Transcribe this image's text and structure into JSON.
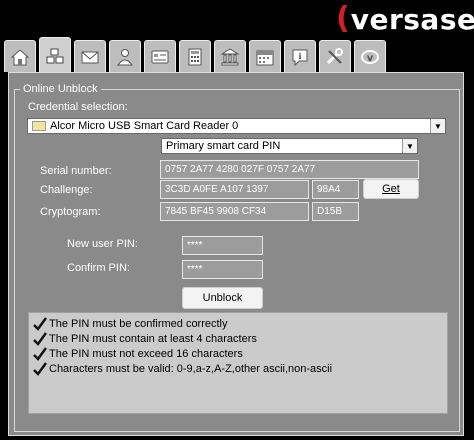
{
  "brand": {
    "logo_text": "versasec"
  },
  "tabs": [
    {
      "icon": "home-icon"
    },
    {
      "icon": "tools-grid-icon",
      "active": true
    },
    {
      "icon": "envelope-icon"
    },
    {
      "icon": "operator-icon"
    },
    {
      "icon": "id-card-icon"
    },
    {
      "icon": "calculator-icon"
    },
    {
      "icon": "bank-icon"
    },
    {
      "icon": "calendar-icon"
    },
    {
      "icon": "info-icon"
    },
    {
      "icon": "wrench-icon"
    },
    {
      "icon": "cv-logo-icon"
    }
  ],
  "section": {
    "title": "Online Unblock"
  },
  "credential": {
    "label": "Credential selection:",
    "reader_value": "Alcor Micro USB Smart Card Reader 0",
    "pin_type_value": "Primary smart card PIN"
  },
  "serial": {
    "label": "Serial number:",
    "value": "0757 2A77 4280 027F 0757 2A77"
  },
  "challenge": {
    "label": "Challenge:",
    "value": "3C3D A0FE A107 1397",
    "suffix": "98A4",
    "get_button": "Get"
  },
  "cryptogram": {
    "label": "Cryptogram:",
    "value": "7845 BF45 9908 CF34",
    "suffix": "D15B"
  },
  "new_pin": {
    "label": "New user PIN:",
    "value": "****"
  },
  "confirm_pin": {
    "label": "Confirm PIN:",
    "value": "****"
  },
  "unblock_button": "Unblock",
  "checks": [
    "The PIN must be confirmed correctly",
    "The PIN must contain at least 4 characters",
    "The PIN must not exceed 16 characters",
    "Characters must be valid: 0-9,a-z,A-Z,other ascii,non-ascii"
  ]
}
